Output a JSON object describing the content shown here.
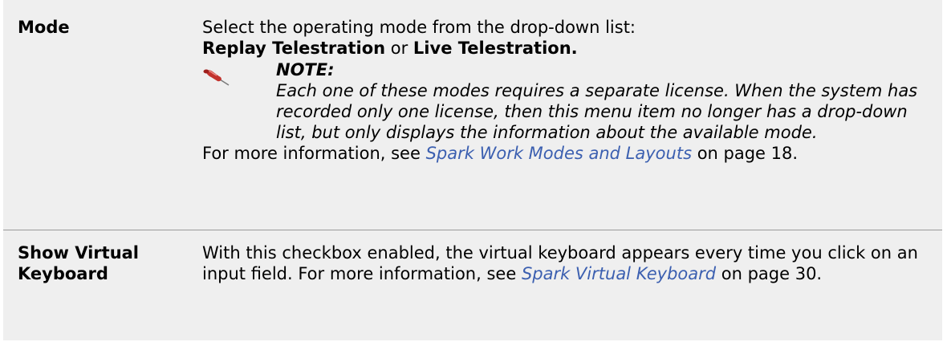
{
  "rows": [
    {
      "term": "Mode",
      "intro": "Select the operating mode from the drop-down list:",
      "option1": "Replay Telestration",
      "or": " or ",
      "option2": "Live Telestration.",
      "note_label": "NOTE:",
      "note_text": "Each one of these modes requires a separate license. When the system has recorded only one license, then this menu item no longer has a drop-down list, but only displays the information about the available mode.",
      "more_prefix": "For more information, see ",
      "more_link": "Spark Work Modes and Layouts",
      "more_suffix": " on page 18."
    },
    {
      "term_line1": "Show Virtual",
      "term_line2": "Keyboard",
      "desc_text": "With this checkbox enabled, the virtual keyboard appears every time you click on an input field. For more information, see ",
      "desc_link": "Spark Virtual Keyboard",
      "desc_suffix": " on page 30."
    }
  ],
  "icons": {
    "note_icon": "pushpin-icon"
  },
  "colors": {
    "row_background": "#efefef",
    "link": "#3b5fb0",
    "divider": "#9a9a9a"
  }
}
